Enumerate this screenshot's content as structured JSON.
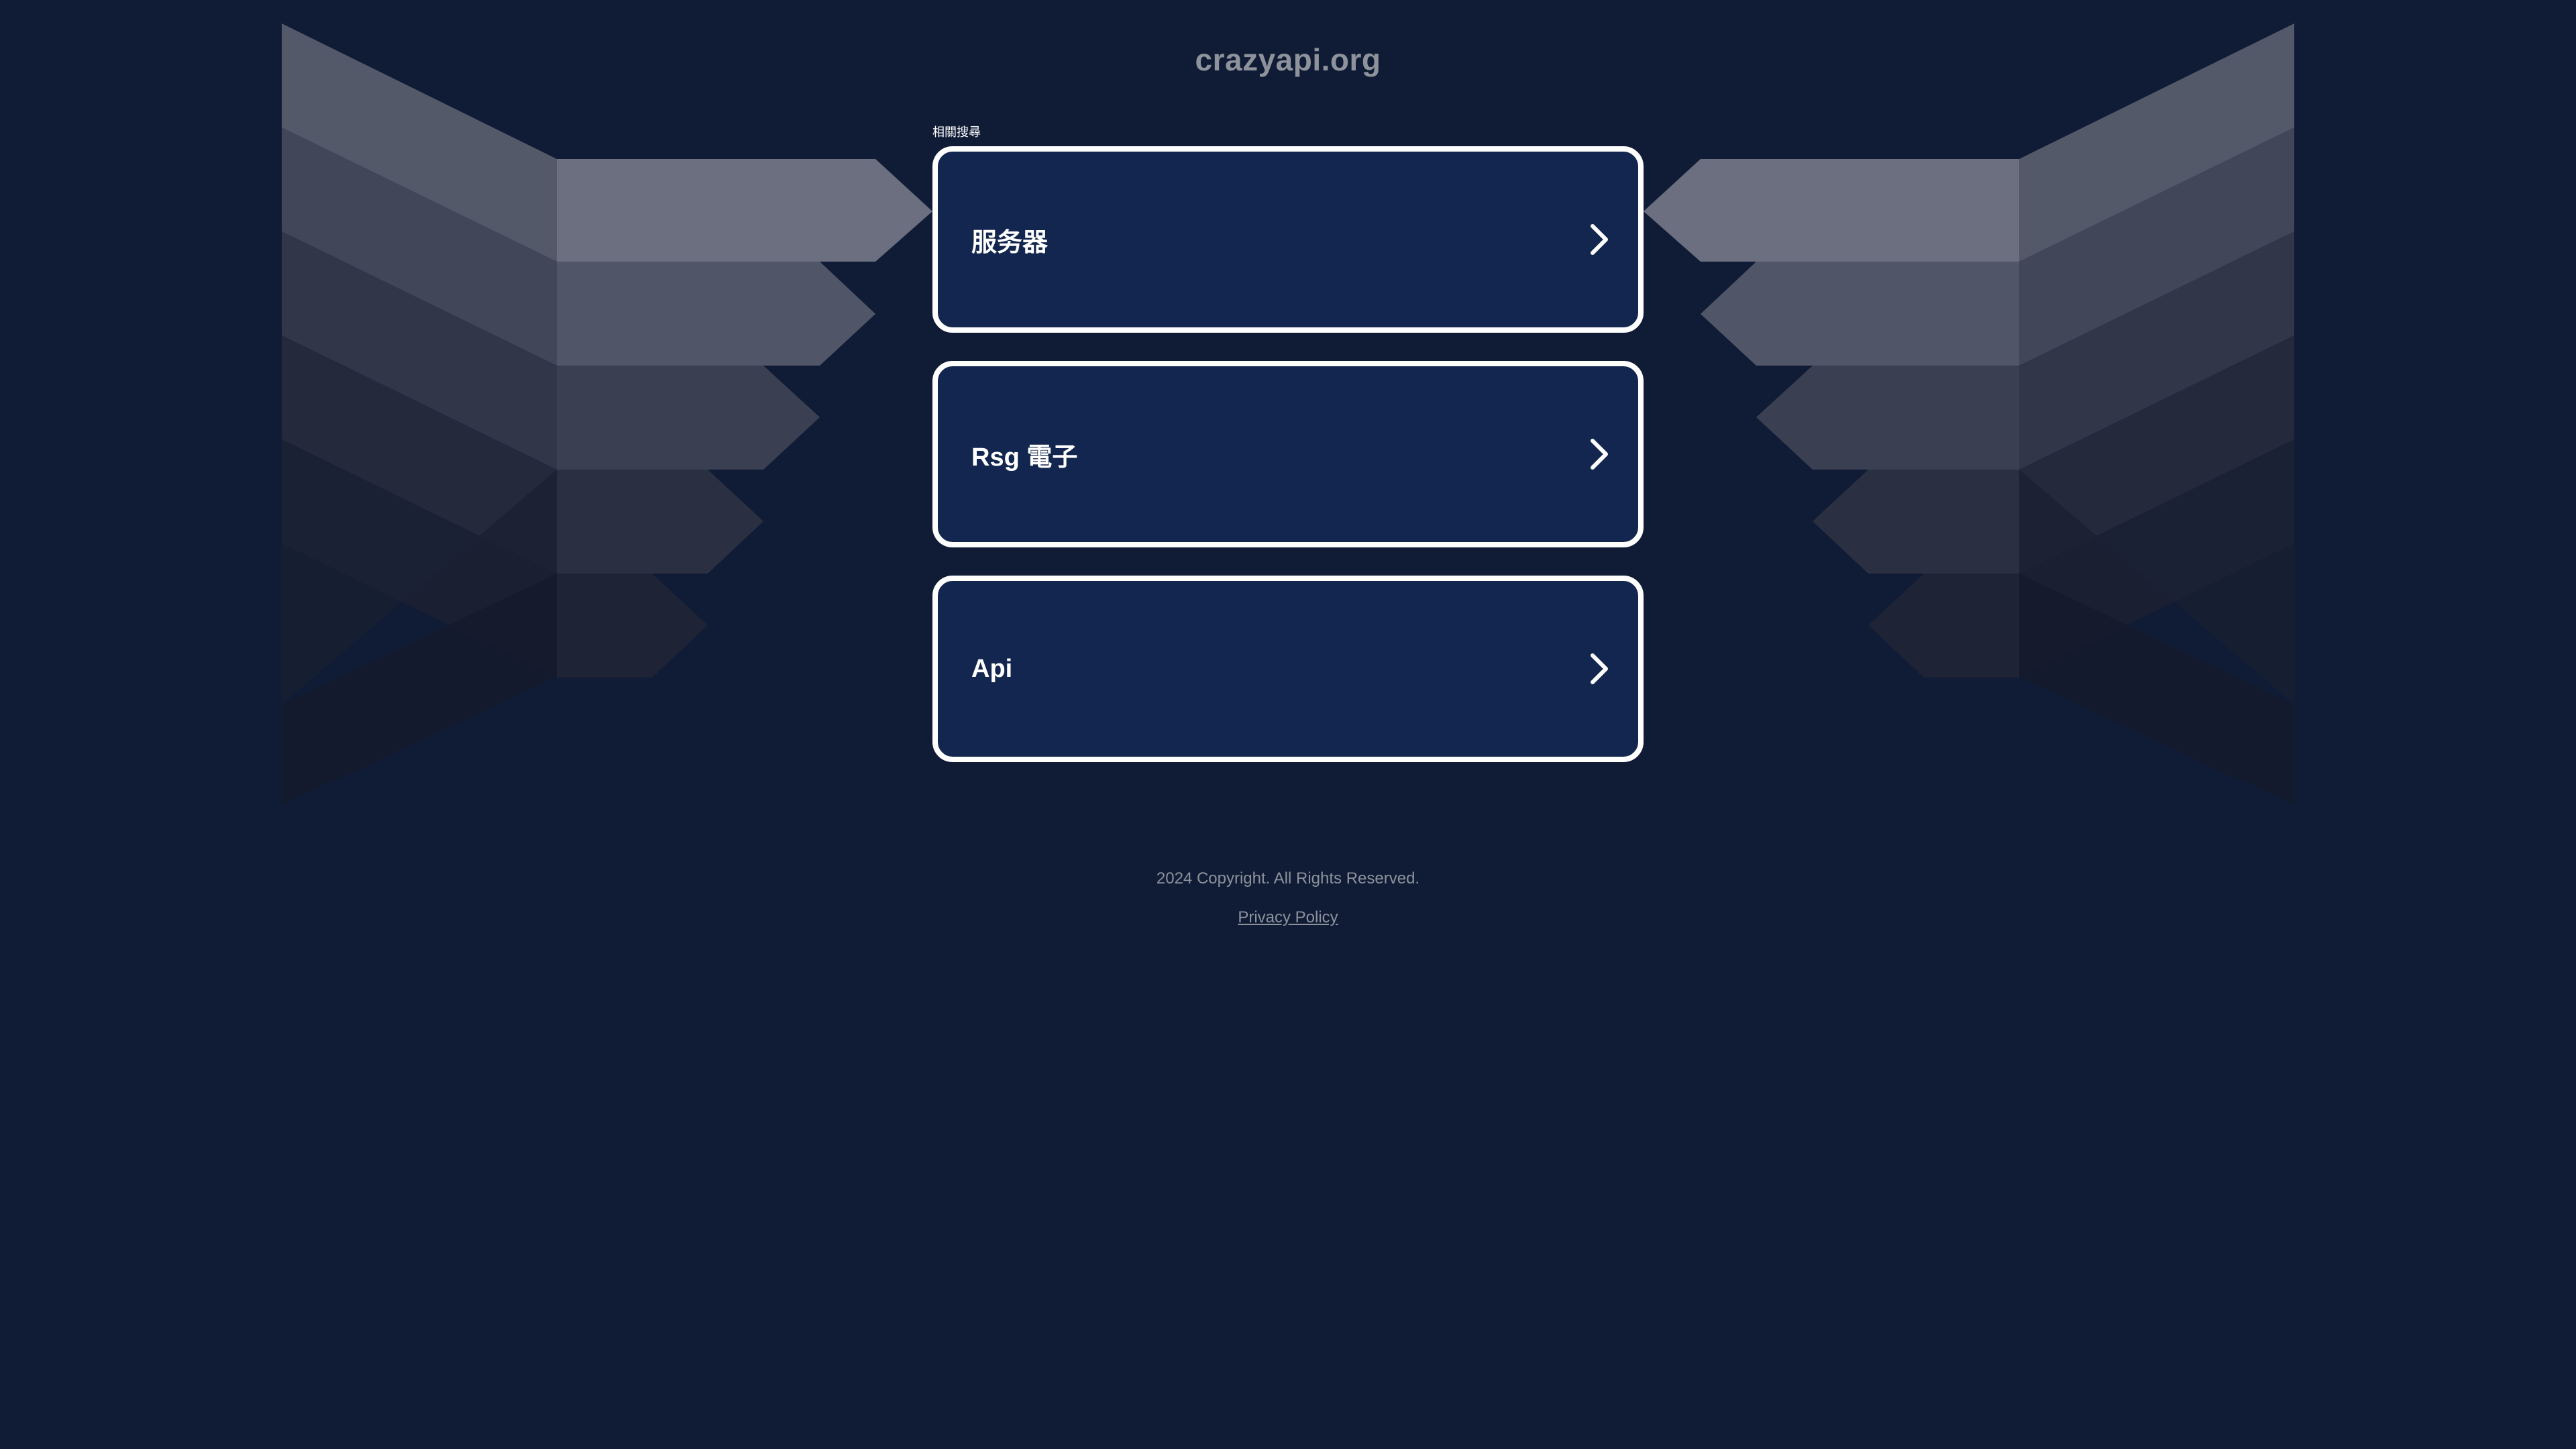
{
  "domain_title": "crazyapi.org",
  "related_searches": {
    "heading": "相關搜尋",
    "items": [
      {
        "label": "服务器"
      },
      {
        "label": "Rsg 電子"
      },
      {
        "label": "Api"
      }
    ]
  },
  "footer": {
    "copyright": "2024 Copyright. All Rights Reserved.",
    "privacy_policy": "Privacy Policy"
  },
  "colors": {
    "background": "#101c36",
    "card_background": "#12264f",
    "card_border": "#ffffff",
    "muted_text": "#8d929b"
  },
  "icons": {
    "card_arrow": "chevron-right-icon"
  }
}
